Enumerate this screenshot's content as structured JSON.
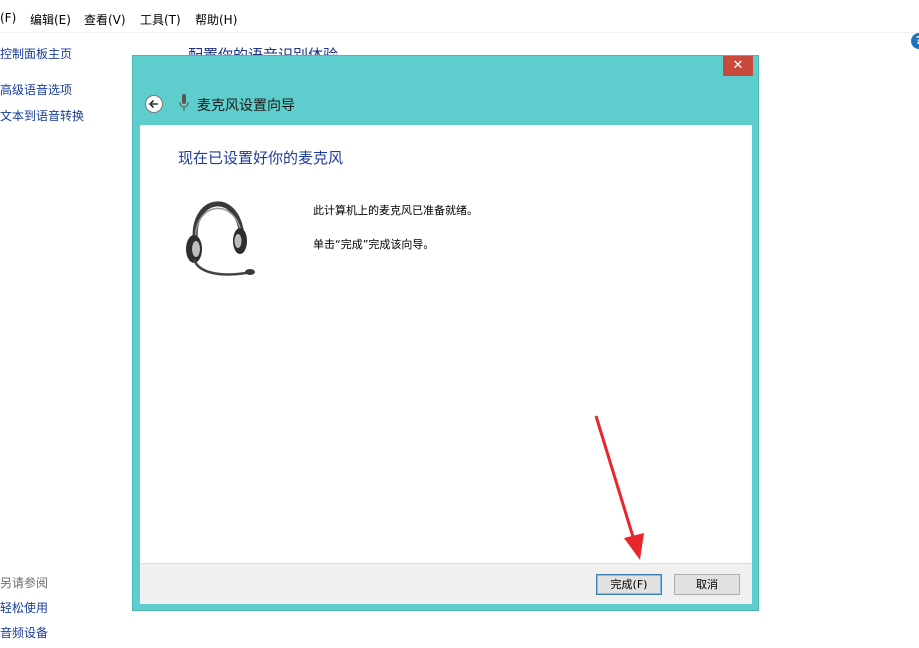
{
  "menubar": {
    "items": [
      "(F)",
      "编辑(E)",
      "查看(V)",
      "工具(T)",
      "帮助(H)"
    ]
  },
  "help_icon": "?",
  "sidebar": {
    "home": "控制面板主页",
    "links": [
      "高级语音选项",
      "文本到语音转换"
    ],
    "see_also_title": "另请参阅",
    "see_also": [
      "轻松使用",
      "音频设备"
    ]
  },
  "background": {
    "heading": "配置你的语音识别体验"
  },
  "dialog": {
    "close_label": "✕",
    "back_icon": "arrow-left-icon",
    "mic_icon": "microphone-icon",
    "title": "麦克风设置向导",
    "heading": "现在已设置好你的麦克风",
    "message_1": "此计算机上的麦克风已准备就绪。",
    "message_2": "单击“完成”完成该向导。",
    "finish_label": "完成(F)",
    "cancel_label": "取消"
  },
  "colors": {
    "dialog_frame": "#5ecdcd",
    "close_button": "#c94a3c",
    "heading_blue": "#1e3c9a",
    "annotation_arrow": "#e8262b"
  }
}
